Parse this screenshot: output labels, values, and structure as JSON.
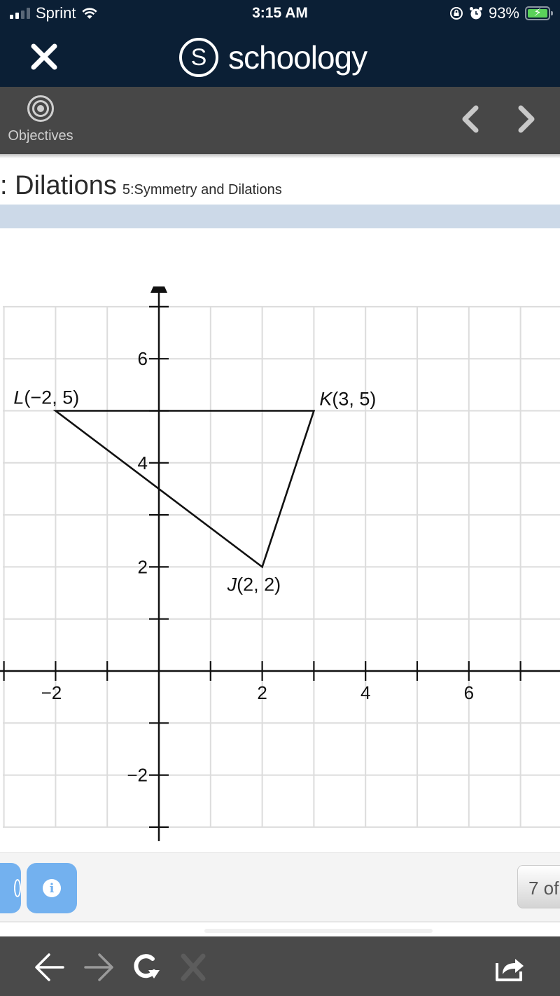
{
  "status_bar": {
    "carrier": "Sprint",
    "time": "3:15 AM",
    "battery_percent": "93%",
    "icons": [
      "signal-icon",
      "wifi-icon",
      "orientation-lock-icon",
      "alarm-icon",
      "battery-charging-icon"
    ]
  },
  "app_bar": {
    "close_icon": "close-icon",
    "logo_letter": "S",
    "logo_text": "schoology"
  },
  "toolbar": {
    "objectives_label": "Objectives",
    "prev_icon": "chevron-left-icon",
    "next_icon": "chevron-right-icon"
  },
  "page": {
    "title": ": Dilations",
    "subtitle": "5:Symmetry and Dilations"
  },
  "chart_data": {
    "type": "scatter",
    "title": "",
    "xlabel": "",
    "ylabel": "",
    "xlim": [
      -3,
      7.5
    ],
    "ylim": [
      -3,
      7.5
    ],
    "grid": true,
    "x_ticks": [
      -3,
      -2,
      -1,
      1,
      2,
      3,
      4,
      5,
      6,
      7
    ],
    "y_ticks": [
      -3,
      -2,
      -1,
      1,
      2,
      3,
      4,
      5,
      6,
      7
    ],
    "x_tick_labels": [
      {
        "value": -2,
        "label": "−2"
      },
      {
        "value": 2,
        "label": "2"
      },
      {
        "value": 4,
        "label": "4"
      },
      {
        "value": 6,
        "label": "6"
      }
    ],
    "y_tick_labels": [
      {
        "value": 6,
        "label": "6"
      },
      {
        "value": 4,
        "label": "4"
      },
      {
        "value": 2,
        "label": "2"
      },
      {
        "value": -2,
        "label": "−2"
      }
    ],
    "polygon": {
      "name": "triangle JKL",
      "vertices": [
        {
          "name": "L",
          "x": -2,
          "y": 5,
          "label": "L(−2, 5)",
          "label_pos": "above-left"
        },
        {
          "name": "K",
          "x": 3,
          "y": 5,
          "label": "K(3, 5)",
          "label_pos": "above-right"
        },
        {
          "name": "J",
          "x": 2,
          "y": 2,
          "label": "J(2, 2)",
          "label_pos": "below"
        }
      ]
    }
  },
  "bottom_panel": {
    "info_button_icon": "info-icon",
    "partial_button_icon": "help-icon",
    "page_counter": "7 of"
  },
  "browser_bar": {
    "icons": [
      "back-arrow-icon",
      "forward-arrow-icon",
      "reload-icon",
      "stop-icon",
      "share-icon"
    ]
  }
}
